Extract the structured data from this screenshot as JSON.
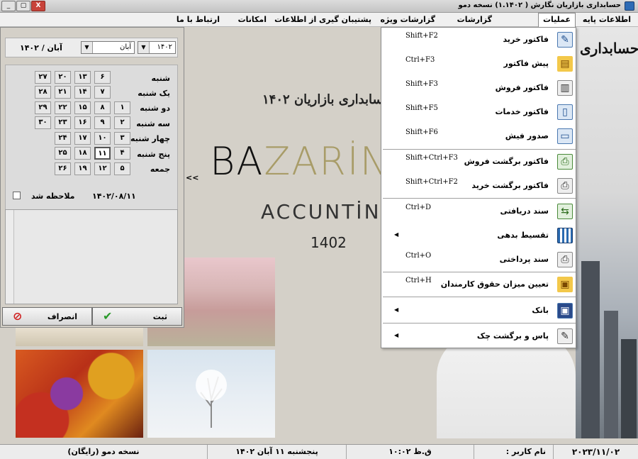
{
  "window": {
    "title": "حسابداری بازاریان نگارش ( ۱.۱۴۰۲) نسخه دمو",
    "buttons": [
      "_",
      "▢",
      "X"
    ]
  },
  "menubar": {
    "items": [
      "اطلاعات پایه",
      "عملیات",
      "گزارشات",
      "گزارشات ویژه",
      "پشتیبان گیری از اطلاعات",
      "امکانات",
      "ارتباط با ما"
    ],
    "active": "عملیات"
  },
  "dropdown": {
    "items": [
      {
        "label": "فاکتور خرید",
        "shortcut": "Shift+F2",
        "icon": "invoice-pencil-icon"
      },
      {
        "label": "پیش فاکتور",
        "shortcut": "Ctrl+F3",
        "icon": "proforma-icon"
      },
      {
        "label": "فاکتور فروش",
        "shortcut": "Shift+F3",
        "icon": "sales-invoice-icon"
      },
      {
        "label": "فاکتور خدمات",
        "shortcut": "Shift+F5",
        "icon": "service-invoice-icon"
      },
      {
        "label": "صدور فیش",
        "shortcut": "Shift+F6",
        "icon": "receipt-printer-icon"
      },
      {
        "label": "فاکتور برگشت فروش",
        "shortcut": "Shift+Ctrl+F3",
        "icon": "sales-return-icon"
      },
      {
        "label": "فاکتور برگشت خرید",
        "shortcut": "Shift+Ctrl+F2",
        "icon": "purchase-return-icon"
      },
      {
        "label": "سند دریافتی",
        "shortcut": "Ctrl+D",
        "icon": "receive-document-icon"
      },
      {
        "label": "تقسیط بدهی",
        "shortcut": "",
        "icon": "installment-icon"
      },
      {
        "label": "سند پرداختی",
        "shortcut": "Ctrl+O",
        "icon": "payment-document-icon"
      },
      {
        "label": "تعیین میزان حقوق کارمندان",
        "shortcut": "Ctrl+H",
        "icon": "salary-icon"
      },
      {
        "label": "بانک",
        "shortcut": "",
        "icon": "bank-icon"
      },
      {
        "label": "پاس و برگشت چک",
        "shortcut": "",
        "icon": "cheque-icon"
      }
    ]
  },
  "calendar": {
    "month_label": "آبان / ۱۴۰۲",
    "month_value": "آبان",
    "year_value": "۱۴۰۲",
    "days": [
      "شنبه",
      "یک شنبه",
      "دو شنبه",
      "سه شنبه",
      "چهار شنبه",
      "پنج شنبه",
      "جمعه"
    ],
    "weeks": [
      [
        "",
        "",
        "۱",
        "۲",
        "۳",
        "۴",
        "۵"
      ],
      [
        "۶",
        "۷",
        "۸",
        "۹",
        "۱۰",
        "۱۱",
        "۱۲"
      ],
      [
        "۱۳",
        "۱۴",
        "۱۵",
        "۱۶",
        "۱۷",
        "۱۸",
        "۱۹"
      ],
      [
        "۲۰",
        "۲۱",
        "۲۲",
        "۲۳",
        "۲۴",
        "۲۵",
        "۲۶"
      ],
      [
        "۲۷",
        "۲۸",
        "۲۹",
        "۳۰",
        "",
        "",
        ""
      ]
    ],
    "today": "۱۱",
    "date_text": "۱۴۰۲/۰۸/۱۱",
    "seen_label": "ملاحظه شد",
    "save_label": "ثبت",
    "cancel_label": "انصراف",
    "collapse": "<<"
  },
  "logo": {
    "persian": "حسابداری بازاریان ۱۴۰۲",
    "brand_dark": "BA",
    "brand_gold": "ZARİN",
    "subtitle": "ACCUNTİNG",
    "year": "1402",
    "side_brand": "حسابداری"
  },
  "statusbar": {
    "date": "۲۰۲۳/۱۱/۰۲",
    "user_label": "نام کاربر :",
    "time": "ق.ظ ۱۰:۰۲",
    "weekday_date": "پنجشنبه ۱۱ آبان ۱۴۰۲",
    "edition": "نسخه دمو (رایگان)"
  }
}
